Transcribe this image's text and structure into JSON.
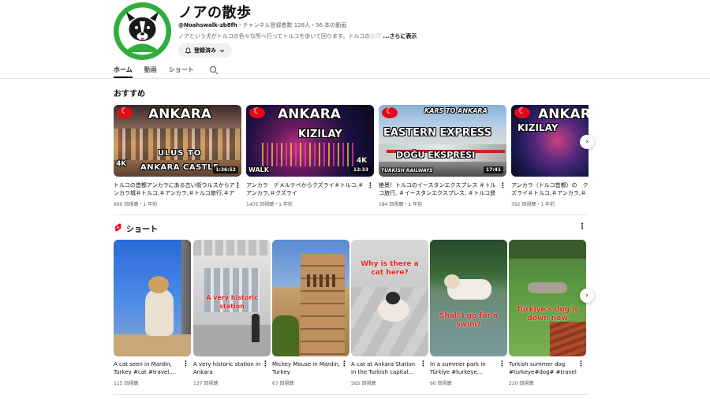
{
  "channel": {
    "title": "ノアの散歩",
    "handle": "@Noahswalk-zb8fh",
    "meta": "・チャンネル登録者数 128人・56 本の動画",
    "description": "ノアという犬がトルコの色々な所へ行ってトルコを歩いて回ります。トルコの",
    "description_faded": "自然",
    "more": "...さらに表示",
    "subscribe_label": "登録済み",
    "brand_color": "#2fae3c"
  },
  "tabs": [
    {
      "label": "ホーム",
      "active": true
    },
    {
      "label": "動画",
      "active": false
    },
    {
      "label": "ショート",
      "active": false
    }
  ],
  "recommended": {
    "title": "おすすめ",
    "videos": [
      {
        "thumb_lines": [
          "ANKARA",
          "ULUS TO",
          "ANKARA CASTLE"
        ],
        "badge": "4K",
        "duration": "1:36:52",
        "title": "トルコの首都アンカラにある古い街ウルスからアンカラ城＃トルコ,＃アンカラ,＃トルコ旅行,＃アンカ...",
        "meta": "690 回視聴・1 年前"
      },
      {
        "thumb_lines": [
          "ANKARA",
          "KIZILAY",
          "WALK"
        ],
        "badge": "4K",
        "duration": "12:33",
        "title": "アンカラ　デメルテペからクズライ＃トルコ,＃アンカラ,＃クズライ",
        "meta": "1405 回視聴・1 年前"
      },
      {
        "thumb_lines": [
          "KARS TO ANKARA",
          "EASTERN EXPRESS",
          "DOĞU EKSPRESI",
          "TURKISH RAILWAYS"
        ],
        "badge": "",
        "duration": "17:41",
        "title": "絶景！トルコのイースタンエクスプレス ＃トルコ旅行, ＃イースタンエクスプレス, ＃トルコ鉄道, ...",
        "meta": "184 回視聴・1 年前"
      },
      {
        "thumb_lines": [
          "ANKAR",
          "KIZILAY"
        ],
        "badge": "",
        "duration": "",
        "title": "アンカラ（トルコ首都）の　クズライ＃トルコ,＃アンカラ,＃クズライ ＃散歩",
        "meta": "392 回視聴・1 年前"
      }
    ]
  },
  "shorts": {
    "title": "ショート",
    "items": [
      {
        "caption": "",
        "title": "A cat seen in Mardin, Turkey  #cat #travel,...",
        "meta": "115 回視聴"
      },
      {
        "caption": "A very historic station",
        "title": "A very historic station in Ankara",
        "meta": "137 回視聴"
      },
      {
        "caption": "",
        "title": "Mickey Mouse in Mardin, Turkey",
        "meta": "67 回視聴"
      },
      {
        "caption": "Why is there a cat here?",
        "title": "A cat at Ankara Station in the Turkish capital...",
        "meta": "565 回視聴"
      },
      {
        "caption": "Shall I go for a swim?",
        "title": "In a summer park in Türkiye #turkeye...",
        "meta": "66 回視聴"
      },
      {
        "caption": "Türkiye's dog is down now",
        "title": "Turkish summer dog #turkeye#dog# #travel",
        "meta": "220 回視聴"
      }
    ]
  },
  "icons": {
    "bell": "bell-icon",
    "chevron": "chevron-down-icon",
    "search": "search-icon",
    "more": "more-vert-icon",
    "next": "chevron-right-icon",
    "shorts": "shorts-logo-icon"
  }
}
